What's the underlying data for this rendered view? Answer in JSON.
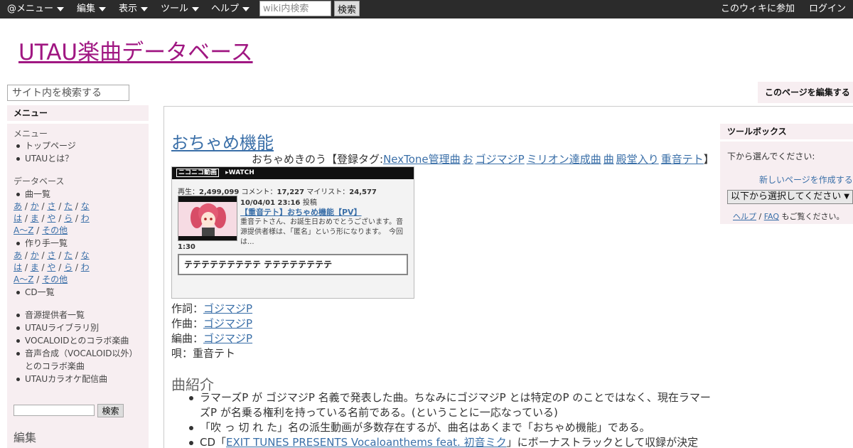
{
  "topbar": {
    "menu": "@メニュー",
    "edit": "編集",
    "view": "表示",
    "tools": "ツール",
    "help": "ヘルプ",
    "search_placeholder": "wiki内検索",
    "search_btn": "検索",
    "join": "このウィキに参加",
    "login": "ログイン"
  },
  "site_title": "UTAU楽曲データベース",
  "site_search_placeholder": "サイト内を検索する",
  "edit_page": "このページを編集する",
  "sidebar": {
    "head": "メニュー",
    "menu_label": "メニュー",
    "top": "トップページ",
    "about": "UTAUとは？",
    "db_label": "データベース",
    "songs": "曲一覧",
    "kana1": [
      "あ",
      "か",
      "さ",
      "た",
      "な"
    ],
    "kana2": [
      "は",
      "ま",
      "や",
      "ら",
      "わ"
    ],
    "kana3": [
      "A～Z",
      "その他"
    ],
    "creators": "作り手一覧",
    "cds": "CD一覧",
    "voicebanks": "音源提供者一覧",
    "by_library": "UTAUライブラリ別",
    "vocaloid_collab": "VOCALOIDとのコラボ楽曲",
    "synth_collab_1": "音声合成（VOCALOID以外）",
    "synth_collab_2": "とのコラボ楽曲",
    "karaoke": "UTAUカラオケ配信曲",
    "search_btn": "検索",
    "edit_section": "編集"
  },
  "main": {
    "title": "おちゃめ機能",
    "reading": "おちゃめきのう【登録タグ:",
    "tags": [
      "NexTone管理曲",
      "お",
      "ゴジマジP",
      "ミリオン達成曲",
      "曲",
      "殿堂入り",
      "重音テト"
    ],
    "tag_close": "】",
    "nico": {
      "logo": "ニコニコ動画",
      "watch": "▸WATCH",
      "plays_label": "再生：",
      "plays": "2,499,099",
      "comments_label": "コメント：",
      "comments": "17,227",
      "mylist_label": "マイリスト：",
      "mylist": "24,577",
      "date": "10/04/01 23:16",
      "posted": "投稿",
      "video_title": "【重音テト】おちゃめ機能【PV】",
      "desc": "重音テトさん、お誕生日おめでとうございます。音源提供者様は、「匿名」という形になります。　今回は...",
      "duration": "1:30",
      "comment": "テテテテテテテテテ テテテテテテテテ"
    },
    "lyrics_label": "作詞：",
    "lyrics": "ゴジマジP",
    "composer_label": "作曲：",
    "composer": "ゴジマジP",
    "arranger_label": "編曲：",
    "arranger": "ゴジマジP",
    "vocal_label": "唄：",
    "vocal": "重音テト",
    "section": "曲紹介",
    "intro1": "ラマーズP が ゴジマジP 名義で発表した曲。ちなみにゴジマジP とは特定のP のことではなく、現在ラマーズP が名乗る権利を持っている名前である。(ということに一応なっている)",
    "intro2": "「吹 っ 切 れ た」名の派生動画が多数存在するが、曲名はあくまで「おちゃめ機能」である。",
    "intro3_pre": "CD「",
    "intro3_link": "EXIT TUNES PRESENTS Vocaloanthems feat. 初音ミク",
    "intro3_post": "」にボーナストラックとして収録が決定し、"
  },
  "toolbox": {
    "head": "ツールボックス",
    "prompt": "下から選んでください:",
    "new_page": "新しいページを作成する",
    "select": "以下から選択してください",
    "help": "ヘルプ",
    "faq": "FAQ",
    "suffix": "もご覧ください。"
  }
}
